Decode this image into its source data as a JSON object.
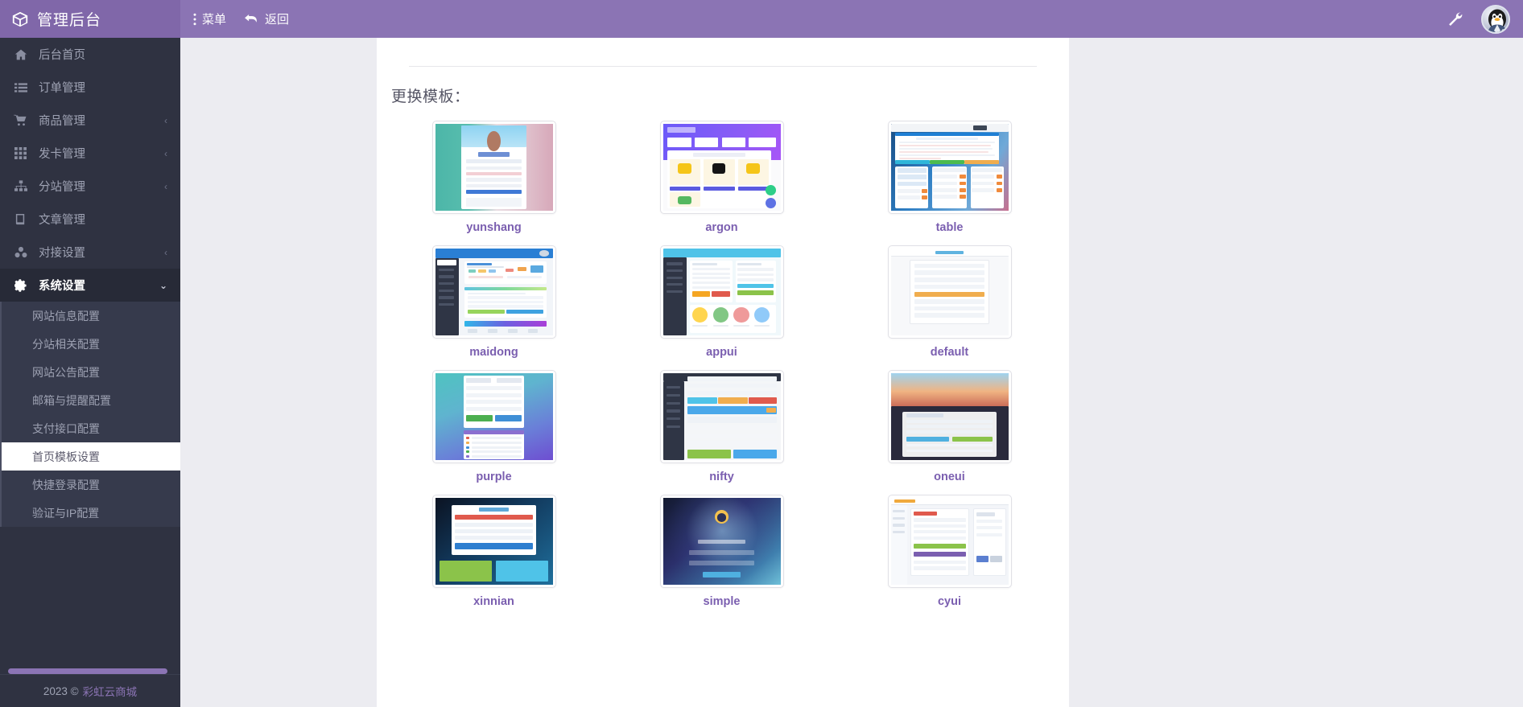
{
  "topbar": {
    "logo_icon": "cube-icon",
    "brand_title": "管理后台",
    "menu_label": "菜单",
    "menu_icon": "dots-vertical-icon",
    "back_label": "返回",
    "back_icon": "undo-arrow-icon",
    "wrench_icon": "wrench-icon",
    "avatar_icon": "qq-penguin-avatar",
    "brand_bg": "#8067a9",
    "bar_bg": "#8b74b4"
  },
  "sidebar": {
    "bg": "#2f3241",
    "items": [
      {
        "label": "后台首页",
        "icon": "home-icon",
        "caret": "",
        "active": false
      },
      {
        "label": "订单管理",
        "icon": "list-icon",
        "caret": "",
        "active": false
      },
      {
        "label": "商品管理",
        "icon": "cart-icon",
        "caret": "‹",
        "active": false
      },
      {
        "label": "发卡管理",
        "icon": "grid-icon",
        "caret": "‹",
        "active": false
      },
      {
        "label": "分站管理",
        "icon": "sitemap-icon",
        "caret": "‹",
        "active": false
      },
      {
        "label": "文章管理",
        "icon": "book-icon",
        "caret": "",
        "active": false
      },
      {
        "label": "对接设置",
        "icon": "cubes-icon",
        "caret": "‹",
        "active": false
      },
      {
        "label": "系统设置",
        "icon": "gear-icon",
        "caret": "⌄",
        "active": true
      }
    ],
    "submenu": [
      {
        "label": "网站信息配置",
        "selected": false
      },
      {
        "label": "分站相关配置",
        "selected": false
      },
      {
        "label": "网站公告配置",
        "selected": false
      },
      {
        "label": "邮箱与提醒配置",
        "selected": false
      },
      {
        "label": "支付接口配置",
        "selected": false
      },
      {
        "label": "首页模板设置",
        "selected": true
      },
      {
        "label": "快捷登录配置",
        "selected": false
      },
      {
        "label": "验证与IP配置",
        "selected": false
      }
    ],
    "footer": {
      "year": "2023 ©",
      "brand": "彩虹云商城",
      "brand_color": "#8b74b4"
    },
    "scrollbar_color": "#8b74b4"
  },
  "main": {
    "heading": "更换模板：",
    "name_color": "#7b5fb0",
    "templates": [
      {
        "name": "yunshang",
        "style": "yun"
      },
      {
        "name": "argon",
        "style": "arg"
      },
      {
        "name": "table",
        "style": "tab"
      },
      {
        "name": "maidong",
        "style": "mai"
      },
      {
        "name": "appui",
        "style": "app-t"
      },
      {
        "name": "default",
        "style": "def"
      },
      {
        "name": "purple",
        "style": "pur"
      },
      {
        "name": "nifty",
        "style": "nif"
      },
      {
        "name": "oneui",
        "style": "one"
      },
      {
        "name": "xinnian",
        "style": "xin"
      },
      {
        "name": "simple",
        "style": "sim"
      },
      {
        "name": "cyui",
        "style": "cyu"
      }
    ]
  }
}
